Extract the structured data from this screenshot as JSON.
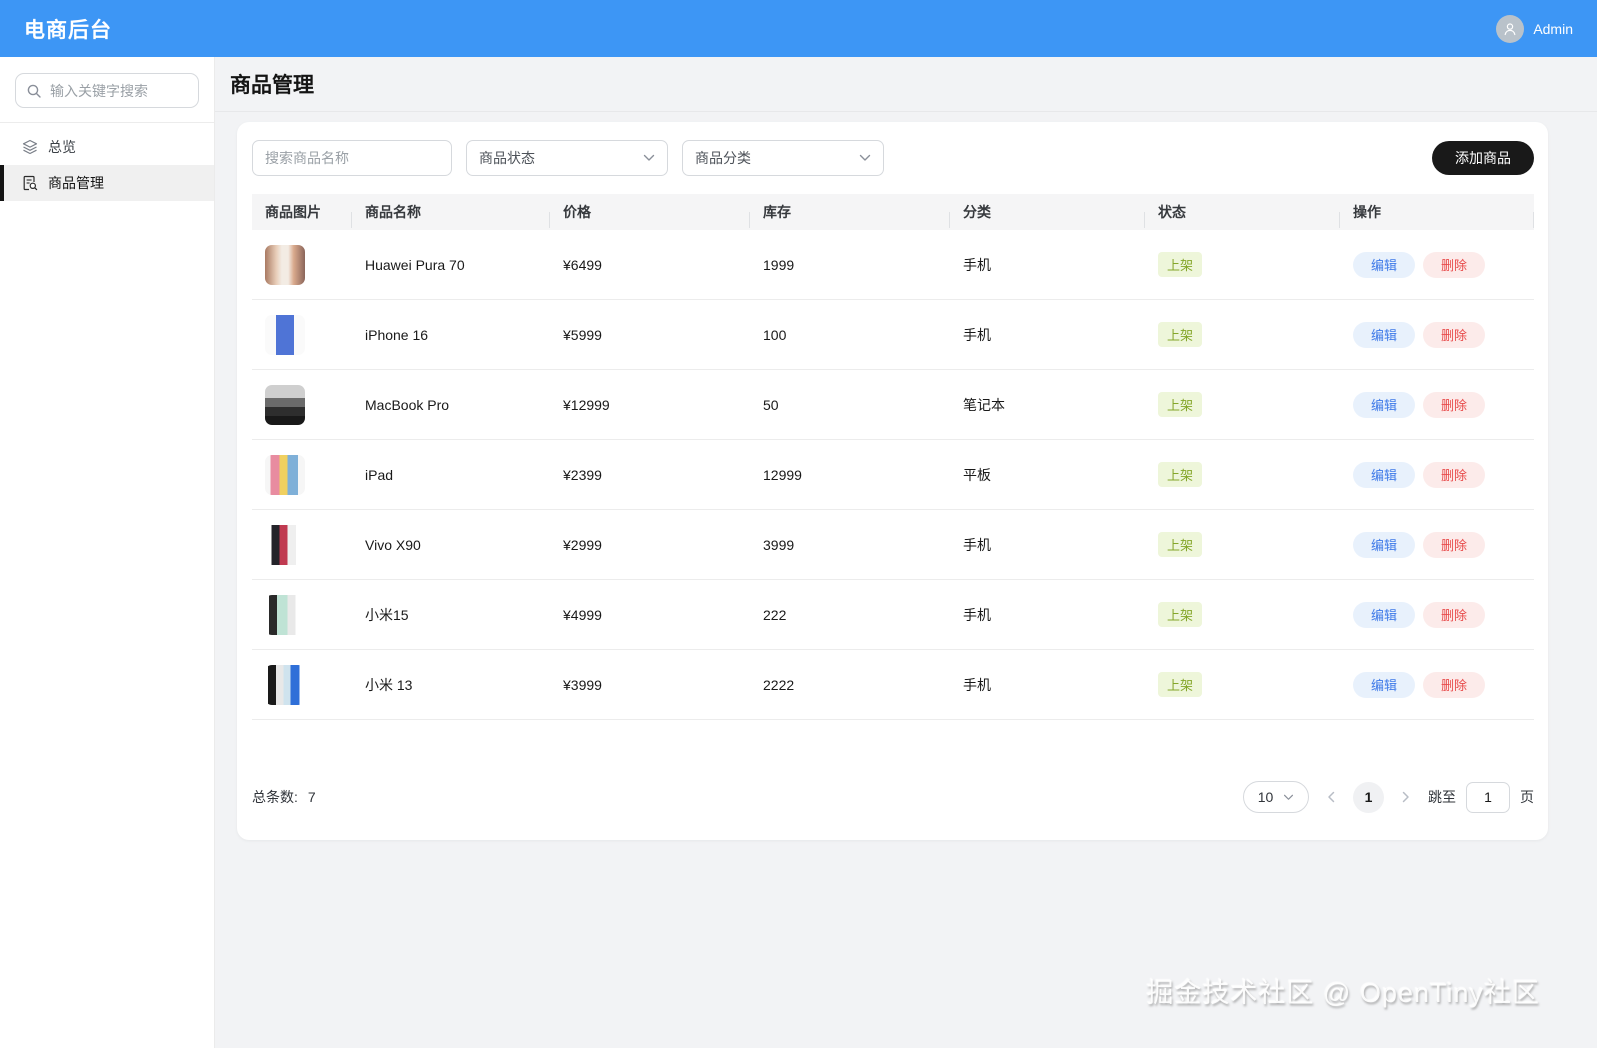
{
  "header": {
    "title": "电商后台",
    "user": "Admin"
  },
  "sidebar": {
    "search_placeholder": "输入关键字搜索",
    "items": [
      {
        "label": "总览",
        "icon": "layers-icon",
        "active": false
      },
      {
        "label": "商品管理",
        "icon": "document-search-icon",
        "active": true
      }
    ]
  },
  "page": {
    "title": "商品管理"
  },
  "filters": {
    "search_placeholder": "搜索商品名称",
    "status_placeholder": "商品状态",
    "category_placeholder": "商品分类",
    "add_button": "添加商品"
  },
  "table": {
    "columns": [
      "商品图片",
      "商品名称",
      "价格",
      "库存",
      "分类",
      "状态",
      "操作"
    ],
    "actions": {
      "edit": "编辑",
      "delete": "删除"
    },
    "rows": [
      {
        "name": "Huawei Pura 70",
        "price": "¥6499",
        "stock": "1999",
        "category": "手机",
        "status": "上架",
        "thumb": "huawei-pura-70"
      },
      {
        "name": "iPhone 16",
        "price": "¥5999",
        "stock": "100",
        "category": "手机",
        "status": "上架",
        "thumb": "iphone-16"
      },
      {
        "name": "MacBook Pro",
        "price": "¥12999",
        "stock": "50",
        "category": "笔记本",
        "status": "上架",
        "thumb": "macbook-pro"
      },
      {
        "name": "iPad",
        "price": "¥2399",
        "stock": "12999",
        "category": "平板",
        "status": "上架",
        "thumb": "ipad"
      },
      {
        "name": "Vivo X90",
        "price": "¥2999",
        "stock": "3999",
        "category": "手机",
        "status": "上架",
        "thumb": "vivo-x90"
      },
      {
        "name": "小米15",
        "price": "¥4999",
        "stock": "222",
        "category": "手机",
        "status": "上架",
        "thumb": "xiaomi-15"
      },
      {
        "name": "小米 13",
        "price": "¥3999",
        "stock": "2222",
        "category": "手机",
        "status": "上架",
        "thumb": "xiaomi-13"
      }
    ]
  },
  "pagination": {
    "total_label": "总条数:",
    "total": "7",
    "page_size": "10",
    "current_page": "1",
    "jump_label": "跳至",
    "jump_value": "1",
    "jump_suffix": "页"
  },
  "watermark": "掘金技术社区 @ OpenTiny社区",
  "colors": {
    "header_blue": "#3d96f5",
    "content_bg": "#f2f3f5",
    "status_badge_bg": "#eef6da",
    "status_badge_text": "#84a629",
    "edit_bg": "#e8f1fc",
    "edit_text": "#3f7ae8",
    "delete_bg": "#fcebea",
    "delete_text": "#e84b4b",
    "add_button_bg": "#191919"
  }
}
